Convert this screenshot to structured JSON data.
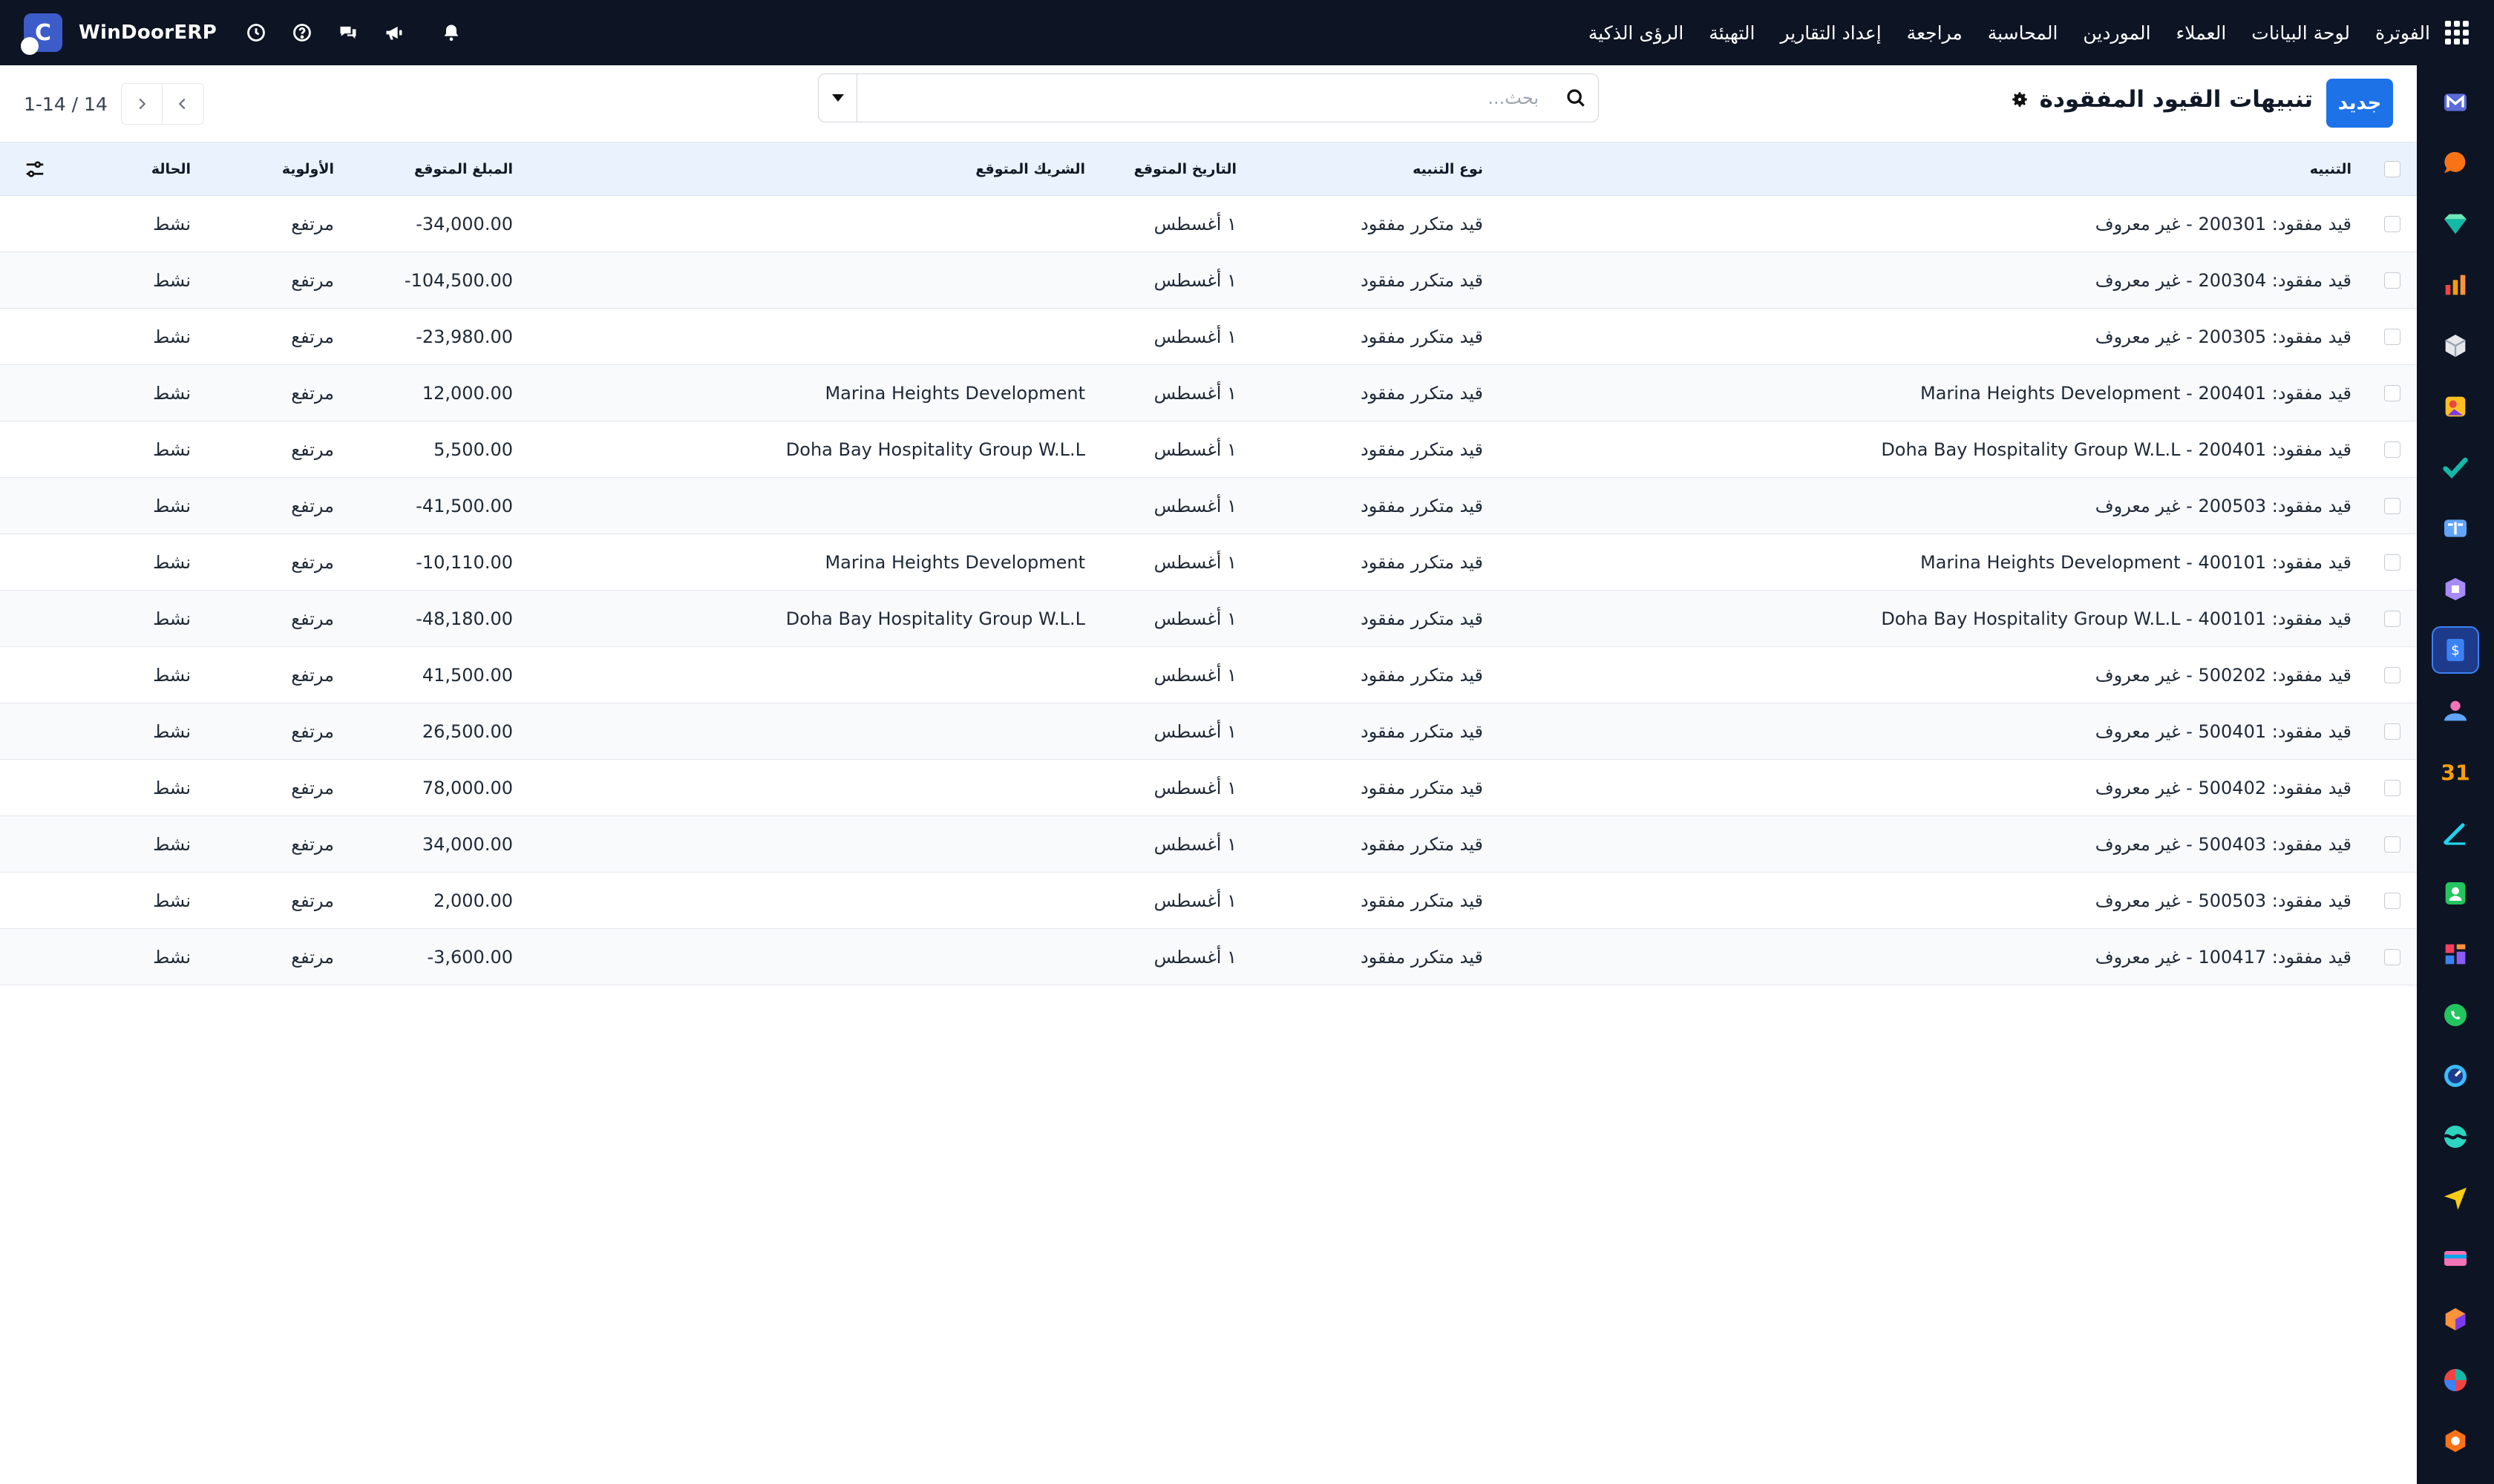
{
  "brand": {
    "name": "WinDoorERP",
    "logo_letter": "C"
  },
  "top_menu": [
    "الفوترة",
    "لوحة البيانات",
    "العملاء",
    "الموردين",
    "المحاسبة",
    "مراجعة",
    "إعداد التقارير",
    "التهيئة",
    "الرؤى الذكية"
  ],
  "top_icons": [
    "bell-icon",
    "megaphone-icon",
    "chat-icon",
    "help-icon",
    "clock-icon"
  ],
  "control": {
    "title": "تنبيهات القيود المفقودة",
    "new_button": "جديد",
    "search_placeholder": "بحث...",
    "pager_text": "1-14 / 14"
  },
  "columns": {
    "alert": "التنبيه",
    "type": "نوع التنبيه",
    "expected_date": "التاريخ المتوقع",
    "expected_partner": "الشريك المتوقع",
    "expected_amount": "المبلغ المتوقع",
    "priority": "الأولوية",
    "status": "الحالة"
  },
  "rows": [
    {
      "alert_prefix": "قيد مفقود:",
      "alert_code": "200301",
      "alert_sep": "-",
      "alert_party": "غير معروف",
      "type": "قيد متكرر مفقود",
      "date": "١ أغسطس",
      "partner": "",
      "amount": "-34,000.00",
      "priority": "مرتفع",
      "status": "نشط"
    },
    {
      "alert_prefix": "قيد مفقود:",
      "alert_code": "200304",
      "alert_sep": "-",
      "alert_party": "غير معروف",
      "type": "قيد متكرر مفقود",
      "date": "١ أغسطس",
      "partner": "",
      "amount": "-104,500.00",
      "priority": "مرتفع",
      "status": "نشط"
    },
    {
      "alert_prefix": "قيد مفقود:",
      "alert_code": "200305",
      "alert_sep": "-",
      "alert_party": "غير معروف",
      "type": "قيد متكرر مفقود",
      "date": "١ أغسطس",
      "partner": "",
      "amount": "-23,980.00",
      "priority": "مرتفع",
      "status": "نشط"
    },
    {
      "alert_prefix": "قيد مفقود:",
      "alert_code": "200401",
      "alert_sep": "-",
      "alert_party": "Marina Heights Development",
      "type": "قيد متكرر مفقود",
      "date": "١ أغسطس",
      "partner": "Marina Heights Development",
      "amount": "12,000.00",
      "priority": "مرتفع",
      "status": "نشط"
    },
    {
      "alert_prefix": "قيد مفقود:",
      "alert_code": "200401",
      "alert_sep": "-",
      "alert_party": "Doha Bay Hospitality Group W.L.L",
      "type": "قيد متكرر مفقود",
      "date": "١ أغسطس",
      "partner": "Doha Bay Hospitality Group W.L.L",
      "amount": "5,500.00",
      "priority": "مرتفع",
      "status": "نشط"
    },
    {
      "alert_prefix": "قيد مفقود:",
      "alert_code": "200503",
      "alert_sep": "-",
      "alert_party": "غير معروف",
      "type": "قيد متكرر مفقود",
      "date": "١ أغسطس",
      "partner": "",
      "amount": "-41,500.00",
      "priority": "مرتفع",
      "status": "نشط"
    },
    {
      "alert_prefix": "قيد مفقود:",
      "alert_code": "400101",
      "alert_sep": "-",
      "alert_party": "Marina Heights Development",
      "type": "قيد متكرر مفقود",
      "date": "١ أغسطس",
      "partner": "Marina Heights Development",
      "amount": "-10,110.00",
      "priority": "مرتفع",
      "status": "نشط"
    },
    {
      "alert_prefix": "قيد مفقود:",
      "alert_code": "400101",
      "alert_sep": "-",
      "alert_party": "Doha Bay Hospitality Group W.L.L",
      "type": "قيد متكرر مفقود",
      "date": "١ أغسطس",
      "partner": "Doha Bay Hospitality Group W.L.L",
      "amount": "-48,180.00",
      "priority": "مرتفع",
      "status": "نشط"
    },
    {
      "alert_prefix": "قيد مفقود:",
      "alert_code": "500202",
      "alert_sep": "-",
      "alert_party": "غير معروف",
      "type": "قيد متكرر مفقود",
      "date": "١ أغسطس",
      "partner": "",
      "amount": "41,500.00",
      "priority": "مرتفع",
      "status": "نشط"
    },
    {
      "alert_prefix": "قيد مفقود:",
      "alert_code": "500401",
      "alert_sep": "-",
      "alert_party": "غير معروف",
      "type": "قيد متكرر مفقود",
      "date": "١ أغسطس",
      "partner": "",
      "amount": "26,500.00",
      "priority": "مرتفع",
      "status": "نشط"
    },
    {
      "alert_prefix": "قيد مفقود:",
      "alert_code": "500402",
      "alert_sep": "-",
      "alert_party": "غير معروف",
      "type": "قيد متكرر مفقود",
      "date": "١ أغسطس",
      "partner": "",
      "amount": "78,000.00",
      "priority": "مرتفع",
      "status": "نشط"
    },
    {
      "alert_prefix": "قيد مفقود:",
      "alert_code": "500403",
      "alert_sep": "-",
      "alert_party": "غير معروف",
      "type": "قيد متكرر مفقود",
      "date": "١ أغسطس",
      "partner": "",
      "amount": "34,000.00",
      "priority": "مرتفع",
      "status": "نشط"
    },
    {
      "alert_prefix": "قيد مفقود:",
      "alert_code": "500503",
      "alert_sep": "-",
      "alert_party": "غير معروف",
      "type": "قيد متكرر مفقود",
      "date": "١ أغسطس",
      "partner": "",
      "amount": "2,000.00",
      "priority": "مرتفع",
      "status": "نشط"
    },
    {
      "alert_prefix": "قيد مفقود:",
      "alert_code": "100417",
      "alert_sep": "-",
      "alert_party": "غير معروف",
      "type": "قيد متكرر مفقود",
      "date": "١ أغسطس",
      "partner": "",
      "amount": "-3,600.00",
      "priority": "مرتفع",
      "status": "نشط"
    }
  ],
  "rail_apps": [
    {
      "icon": "gmail-icon",
      "color": "#5b6bd6"
    },
    {
      "icon": "chat-bubble-icon",
      "color": "#f97316"
    },
    {
      "icon": "diamond-icon",
      "color": "#14b8a6"
    },
    {
      "icon": "bar-chart-icon",
      "color": "#f59e0b"
    },
    {
      "icon": "cube-icon",
      "color": "#e5e7eb"
    },
    {
      "icon": "photo-icon",
      "color": "#fbbf24"
    },
    {
      "icon": "check-icon",
      "color": "#14b8a6"
    },
    {
      "icon": "book-icon",
      "color": "#60a5fa"
    },
    {
      "icon": "box-icon",
      "color": "#a78bfa"
    },
    {
      "icon": "invoice-icon",
      "color": "#3b82f6"
    },
    {
      "icon": "users-icon",
      "color": "#f472b6"
    },
    {
      "icon": "calendar-icon",
      "color": "#f59e0b"
    },
    {
      "icon": "pen-icon",
      "color": "#22d3ee"
    },
    {
      "icon": "contact-icon",
      "color": "#22c55e"
    },
    {
      "icon": "dashboard-icon",
      "color": "#f43f5e"
    },
    {
      "icon": "whatsapp-icon",
      "color": "#22c55e"
    },
    {
      "icon": "gauge-icon",
      "color": "#38bdf8"
    },
    {
      "icon": "wave-icon",
      "color": "#2dd4bf"
    },
    {
      "icon": "send-icon",
      "color": "#facc15"
    },
    {
      "icon": "card-icon",
      "color": "#f472b6"
    },
    {
      "icon": "hex-icon",
      "color": "#fb923c"
    },
    {
      "icon": "pie-icon",
      "color": "#ef4444"
    },
    {
      "icon": "gem-icon",
      "color": "#f97316"
    }
  ],
  "active_rail_index": 9,
  "colors": {
    "topbar": "#0d1424",
    "primary": "#1d72e8",
    "header_row": "#eaf3fd"
  }
}
